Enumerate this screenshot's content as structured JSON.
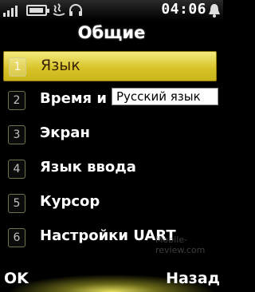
{
  "status_bar": {
    "time": "04:06",
    "icons": [
      "signal-icon",
      "battery-icon",
      "java-icon",
      "headset-icon",
      "alarm-icon"
    ]
  },
  "title": "Общие",
  "menu": {
    "items": [
      {
        "number": "1",
        "label": "Язык",
        "selected": true
      },
      {
        "number": "2",
        "label": "Время и д",
        "selected": false
      },
      {
        "number": "3",
        "label": "Экран",
        "selected": false
      },
      {
        "number": "4",
        "label": "Язык ввода",
        "selected": false
      },
      {
        "number": "5",
        "label": "Курсор",
        "selected": false
      },
      {
        "number": "6",
        "label": "Настройки UART",
        "selected": false
      }
    ]
  },
  "tooltip": "Русский язык",
  "watermark": "Mobile-review.com",
  "softkeys": {
    "left": "OK",
    "right": "Назад"
  },
  "colors": {
    "highlight": "#e0cf3a",
    "background": "#000000",
    "text": "#ffffff"
  }
}
